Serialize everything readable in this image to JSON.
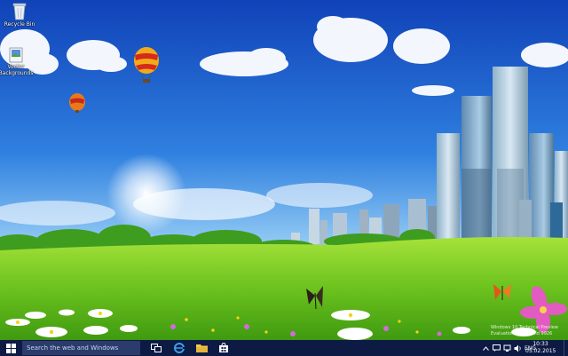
{
  "desktop": {
    "icons": [
      {
        "label": "Recycle Bin",
        "icon": "recycle-bin-icon"
      },
      {
        "label": "Vector Backgrounds",
        "icon": "image-file-icon"
      }
    ],
    "wallpaper": "green-meadow-city-skyline-balloons"
  },
  "taskbar": {
    "search_placeholder": "Search the web and Windows",
    "pinned": [
      {
        "name": "task-view",
        "icon": "task-view-icon"
      },
      {
        "name": "edge",
        "icon": "edge-icon"
      },
      {
        "name": "file-explorer",
        "icon": "folder-icon"
      },
      {
        "name": "store",
        "icon": "store-icon"
      }
    ],
    "tray": {
      "language": "ENG"
    },
    "clock": {
      "time": "10:33",
      "date": "05.02.2015"
    },
    "colors": {
      "taskbar_bg": "#0d1a44",
      "accent": "#2d7bd8"
    }
  },
  "watermark": {
    "lines": [
      "Windows 10 Technical Preview",
      "Evaluation copy. Build 9926"
    ]
  }
}
